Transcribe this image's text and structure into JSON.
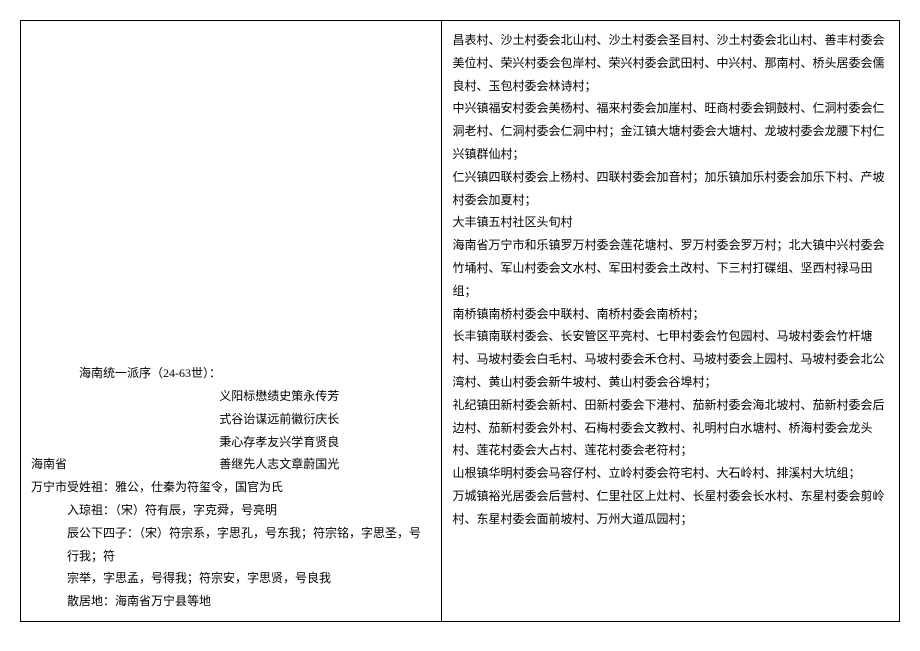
{
  "left": {
    "province": "海南省",
    "paixu_header": "海南统一派序（24-63世）：",
    "paixu_lines": [
      "义阳标懋绩史策永传芳",
      "式谷诒谋远前徽衍庆长",
      "秉心存孝友兴学育贤良",
      "善继先人志文章蔚国光"
    ],
    "shouxing": "万宁市受姓祖：雅公，仕秦为符玺令，国官为氏",
    "ruqiong": "入琼祖：（宋）符有辰，字克舜，号亮明",
    "sizi_label": "辰公下四子：（宋）符宗系，字思孔，号东我；符宗铭，字思圣，号行我；符",
    "sizi_cont": "宗举，字思孟，号得我；符宗安，字思贤，号良我",
    "sanju": "散居地：海南省万宁县等地"
  },
  "right": {
    "p1": "昌表村、沙土村委会北山村、沙土村委会圣目村、沙土村委会北山村、善丰村委会美位村、荣兴村委会包岸村、荣兴村委会武田村、中兴村、那南村、桥头居委会儒良村、玉包村委会林诗村；",
    "p2": "中兴镇福安村委会美杨村、福来村委会加崖村、旺商村委会铜鼓村、仁洞村委会仁洞老村、仁洞村委会仁洞中村；金江镇大塘村委会大塘村、龙坡村委会龙腰下村仁兴镇群仙村；",
    "p3": "仁兴镇四联村委会上杨村、四联村委会加音村；加乐镇加乐村委会加乐下村、产坡村委会加夏村；",
    "p4": "大丰镇五村社区头旬村",
    "p5": "海南省万宁市和乐镇罗万村委会莲花塘村、罗万村委会罗万村；北大镇中兴村委会竹埇村、军山村委会文水村、军田村委会土改村、下三村打碟组、坚西村禄马田组；",
    "p6": "南桥镇南桥村委会中联村、南桥村委会南桥村；",
    "p7": "长丰镇南联村委会、长安管区平亮村、七甲村委会竹包园村、马坡村委会竹杆塘村、马坡村委会白毛村、马坡村委会禾仓村、马坡村委会上园村、马坡村委会北公湾村、黄山村委会新牛坡村、黄山村委会谷埠村；",
    "p8": "礼纪镇田新村委会新村、田新村委会下港村、茄新村委会海北坡村、茄新村委会后边村、茄新村委会外村、石梅村委会文教村、礼明村白水塘村、桥海村委会龙头村、莲花村委会大占村、莲花村委会老符村；",
    "p9": "山根镇华明村委会马容仔村、立岭村委会符宅村、大石岭村、排溪村大坑组；",
    "p10": "万城镇裕光居委会后营村、仁里社区上灶村、长星村委会长水村、东星村委会剪岭村、东星村委会面前坡村、万州大道瓜园村；"
  }
}
